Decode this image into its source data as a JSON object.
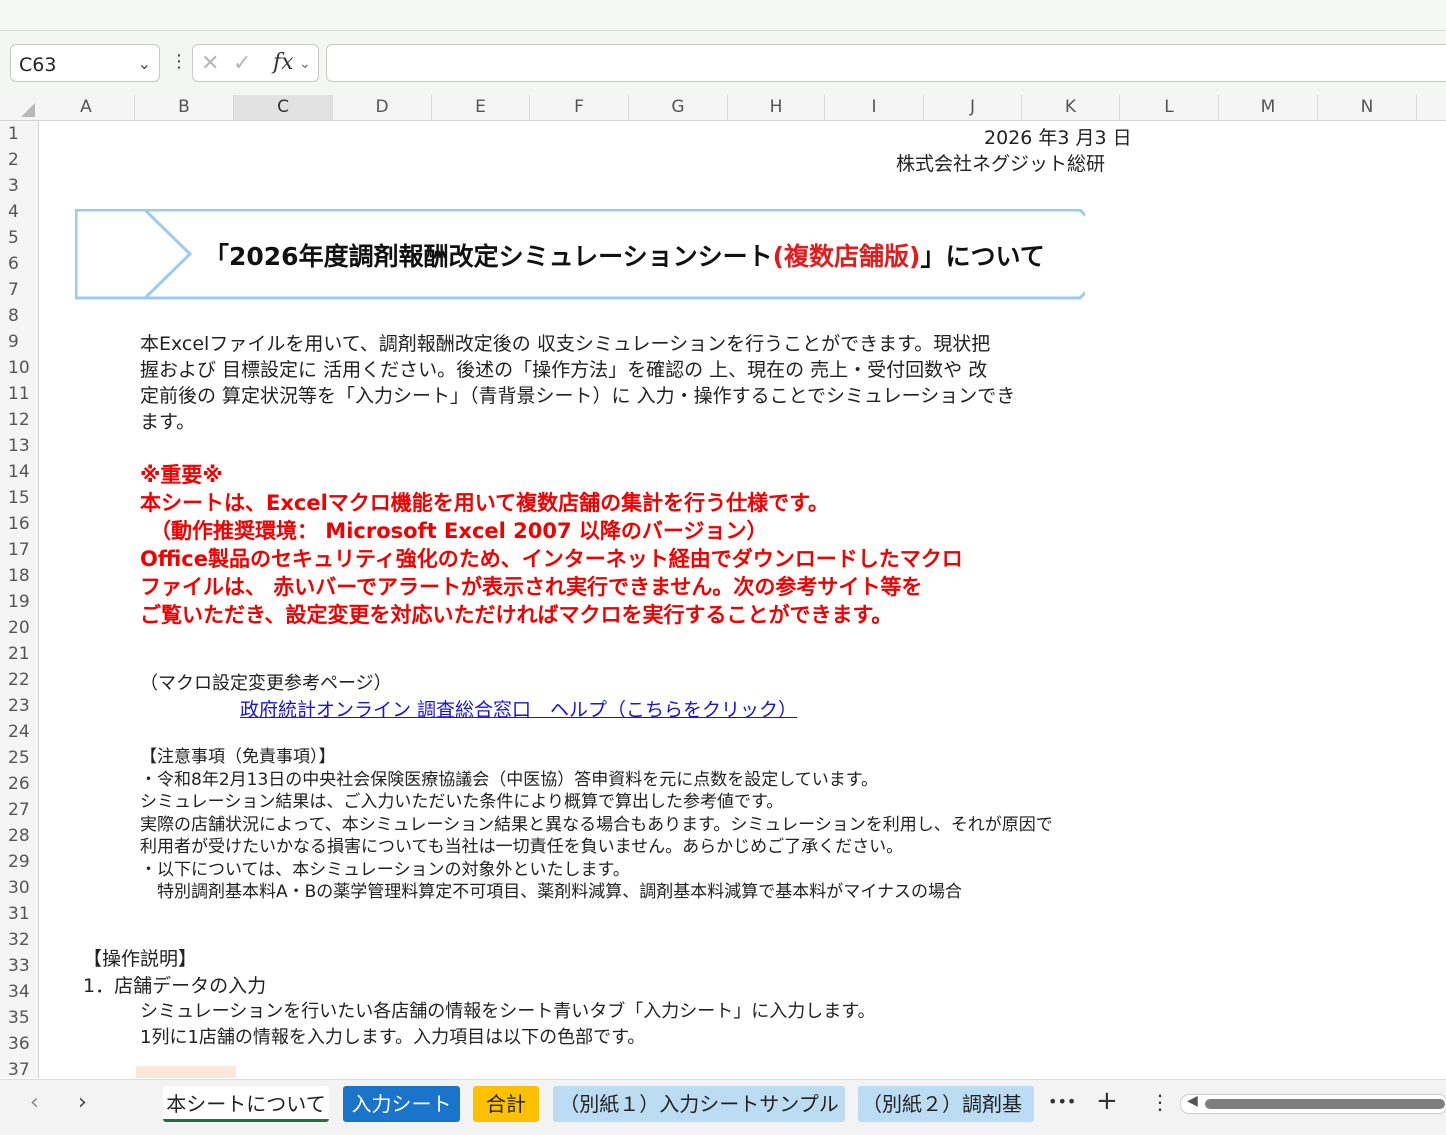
{
  "formula_bar": {
    "name_box": "C63",
    "fx_label": "fx",
    "formula_value": ""
  },
  "columns": [
    "A",
    "B",
    "C",
    "D",
    "E",
    "F",
    "G",
    "H",
    "I",
    "J",
    "K",
    "L",
    "M",
    "N"
  ],
  "selected_column": "C",
  "rows": [
    "1",
    "2",
    "3",
    "4",
    "5",
    "6",
    "7",
    "8",
    "9",
    "10",
    "11",
    "12",
    "13",
    "14",
    "15",
    "16",
    "17",
    "18",
    "19",
    "20",
    "21",
    "22",
    "23",
    "24",
    "25",
    "26",
    "27",
    "28",
    "29",
    "30",
    "31",
    "32",
    "33",
    "34",
    "35",
    "36",
    "37"
  ],
  "sheet": {
    "date": "2026 年3 月3 日",
    "company": "株式会社ネグジット総研",
    "title_pre": "「2026年度調剤報酬改定シミュレーションシート",
    "title_red": "(複数店舗版)",
    "title_post": "」について",
    "intro": [
      "本Excelファイルを用いて、調剤報酬改定後の 収支シミュレーションを行うことができます。現状把",
      "握および 目標設定に 活用ください。後述の「操作方法」を確認の 上、現在の 売上・受付回数や 改",
      "定前後の 算定状況等を「入力シート」（青背景シート）に 入力・操作することでシミュレーションでき",
      "ます。"
    ],
    "important": [
      "※重要※",
      "本シートは、Excelマクロ機能を用いて複数店舗の集計を行う仕様です。",
      "（動作推奨環境： Microsoft Excel 2007 以降のバージョン）",
      "Office製品のセキュリティ強化のため、インターネット経由でダウンロードしたマクロ",
      "ファイルは、 赤いバーでアラートが表示され実行できません。次の参考サイト等を",
      "ご覧いただき、設定変更を対応いただければマクロを実行することができます。"
    ],
    "macro_ref_label": "（マクロ設定変更参考ページ）",
    "macro_link": "政府統計オンライン 調査総合窓口　ヘルプ（こちらをクリック）",
    "notice_title": "【注意事項（免責事項）】",
    "notice_lines": [
      "・令和8年2月13日の中央社会保険医療協議会（中医協）答申資料を元に点数を設定しています。",
      "シミュレーション結果は、ご入力いただいた条件により概算で算出した参考値です。",
      "実際の店舗状況によって、本シミュレーション結果と異なる場合もあります。シミュレーションを利用し、それが原因で",
      "利用者が受けたいかなる損害についても当社は一切責任を負いません。あらかじめご了承ください。",
      "・以下については、本シミュレーションの対象外といたします。",
      "　特別調剤基本料A・Bの薬学管理料算定不可項目、薬剤料減算、調剤基本料減算で基本料がマイナスの場合"
    ],
    "ops_title": "【操作説明】",
    "ops_step1": "1．店舗データの入力",
    "ops_lines": [
      "シミュレーションを行いたい各店舗の情報をシート青いタブ「入力シート」に入力します。",
      "1列に1店舗の情報を入力します。入力項目は以下の色部です。"
    ]
  },
  "tabs": [
    {
      "label": "本シートについて",
      "bg": "#ffffff",
      "color": "#222222"
    },
    {
      "label": "入力シート",
      "bg": "#1a74c9",
      "color": "#ffffff"
    },
    {
      "label": "合計",
      "bg": "#ffc000",
      "color": "#222222"
    },
    {
      "label": "（別紙１）入力シートサンプル",
      "bg": "#bcdcf3",
      "color": "#222222"
    },
    {
      "label": "（別紙２）調剤基",
      "bg": "#bcdcf3",
      "color": "#222222"
    }
  ],
  "tab_controls": {
    "more": "•••",
    "add": "+",
    "menu": "⋮"
  },
  "colors": {
    "accent_green": "#1e7145",
    "red_text": "#f20000",
    "link_blue": "#1a14d8",
    "banner_border": "#9ccbf0"
  }
}
